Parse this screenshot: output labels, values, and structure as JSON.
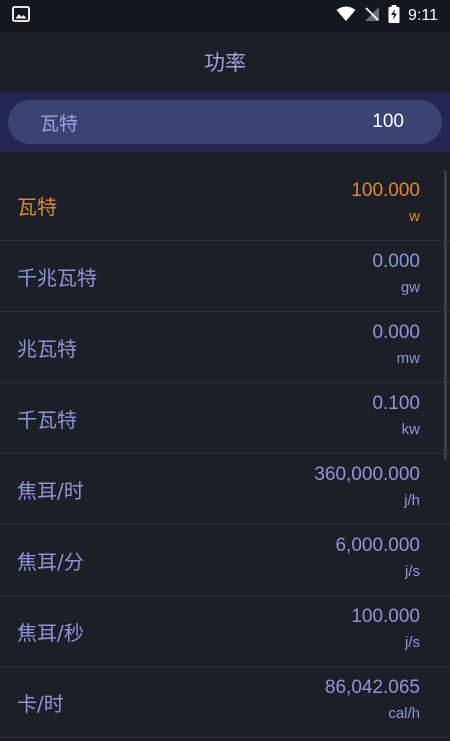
{
  "status_bar": {
    "time": "9:11",
    "icons": [
      "image-icon",
      "wifi-icon",
      "signal-icon",
      "battery-charging-icon"
    ]
  },
  "header": {
    "title": "功率"
  },
  "input": {
    "unit_label": "瓦特",
    "value": "100"
  },
  "rows": [
    {
      "name": "瓦特",
      "value": "100.000",
      "unit": "w",
      "active": true
    },
    {
      "name": "千兆瓦特",
      "value": "0.000",
      "unit": "gw"
    },
    {
      "name": "兆瓦特",
      "value": "0.000",
      "unit": "mw"
    },
    {
      "name": "千瓦特",
      "value": "0.100",
      "unit": "kw"
    },
    {
      "name": "焦耳/时",
      "value": "360,000.000",
      "unit": "j/h"
    },
    {
      "name": "焦耳/分",
      "value": "6,000.000",
      "unit": "j/s"
    },
    {
      "name": "焦耳/秒",
      "value": "100.000",
      "unit": "j/s"
    },
    {
      "name": "卡/时",
      "value": "86,042.065",
      "unit": "cal/h"
    }
  ],
  "colors": {
    "background": "#1c1e28",
    "accent": "#e08a2c",
    "text": "#8e96d8",
    "input_band": "#232650",
    "input_pill": "#3c4373"
  }
}
